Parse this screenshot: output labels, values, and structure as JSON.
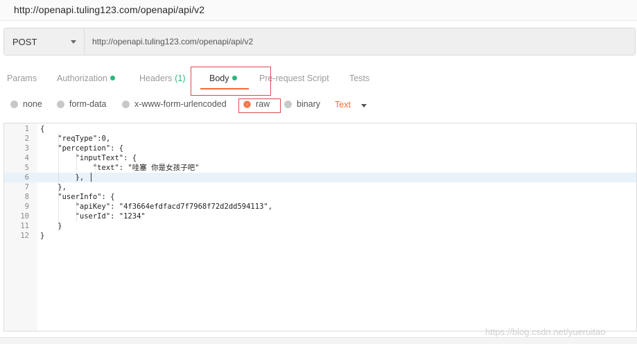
{
  "window": {
    "title": "http://openapi.tuling123.com/openapi/api/v2"
  },
  "request": {
    "method": "POST",
    "url": "http://openapi.tuling123.com/openapi/api/v2"
  },
  "tabs": [
    {
      "label": "Params",
      "active": false
    },
    {
      "label": "Authorization",
      "active": false,
      "dot": true
    },
    {
      "label": "Headers",
      "active": false,
      "count": "(1)"
    },
    {
      "label": "Body",
      "active": true,
      "dot": true
    },
    {
      "label": "Pre-request Script",
      "active": false
    },
    {
      "label": "Tests",
      "active": false
    }
  ],
  "body_types": [
    {
      "label": "none",
      "selected": false
    },
    {
      "label": "form-data",
      "selected": false
    },
    {
      "label": "x-www-form-urlencoded",
      "selected": false
    },
    {
      "label": "raw",
      "selected": true
    },
    {
      "label": "binary",
      "selected": false
    }
  ],
  "format": {
    "selected": "Text"
  },
  "editor": {
    "lines": [
      "{",
      "    \"reqType\":0,",
      "    \"perception\": {",
      "        \"inputText\": {",
      "            \"text\": \"哇塞 你是女孩子吧\"",
      "        },",
      "    },",
      "    \"userInfo\": {",
      "        \"apiKey\": \"4f3664efdfacd7f7968f72d2dd594113\",",
      "        \"userId\": \"1234\"",
      "    }",
      "}"
    ],
    "line_numbers": [
      "1",
      "2",
      "3",
      "4",
      "5",
      "6",
      "7",
      "8",
      "9",
      "10",
      "11",
      "12"
    ],
    "current_line": 6
  },
  "watermark": "https://blog.csdn.net/yueruitao",
  "colors": {
    "accent": "#f26b3a",
    "dot_green": "#2db57e",
    "highlight_red": "#d84a4a"
  }
}
